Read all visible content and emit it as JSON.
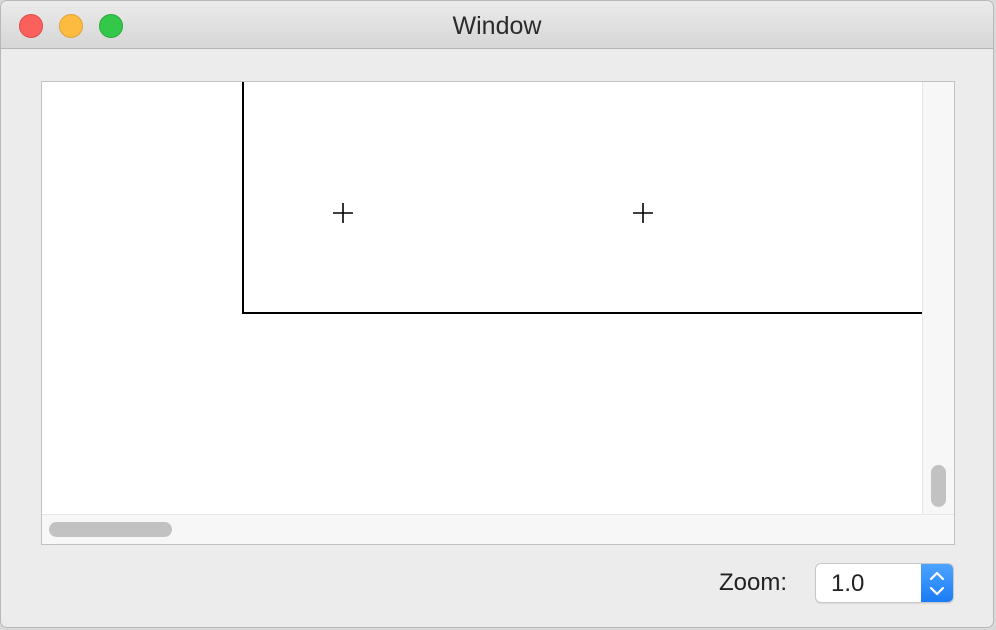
{
  "window": {
    "title": "Window"
  },
  "canvas": {
    "marker_glyph": "crosshair"
  },
  "footer": {
    "zoom_label": "Zoom:",
    "zoom_value": "1.0"
  },
  "colors": {
    "close": "#fc605c",
    "minimize": "#fdbc40",
    "zoom": "#34c84a",
    "accent": "#1a7cf5"
  }
}
